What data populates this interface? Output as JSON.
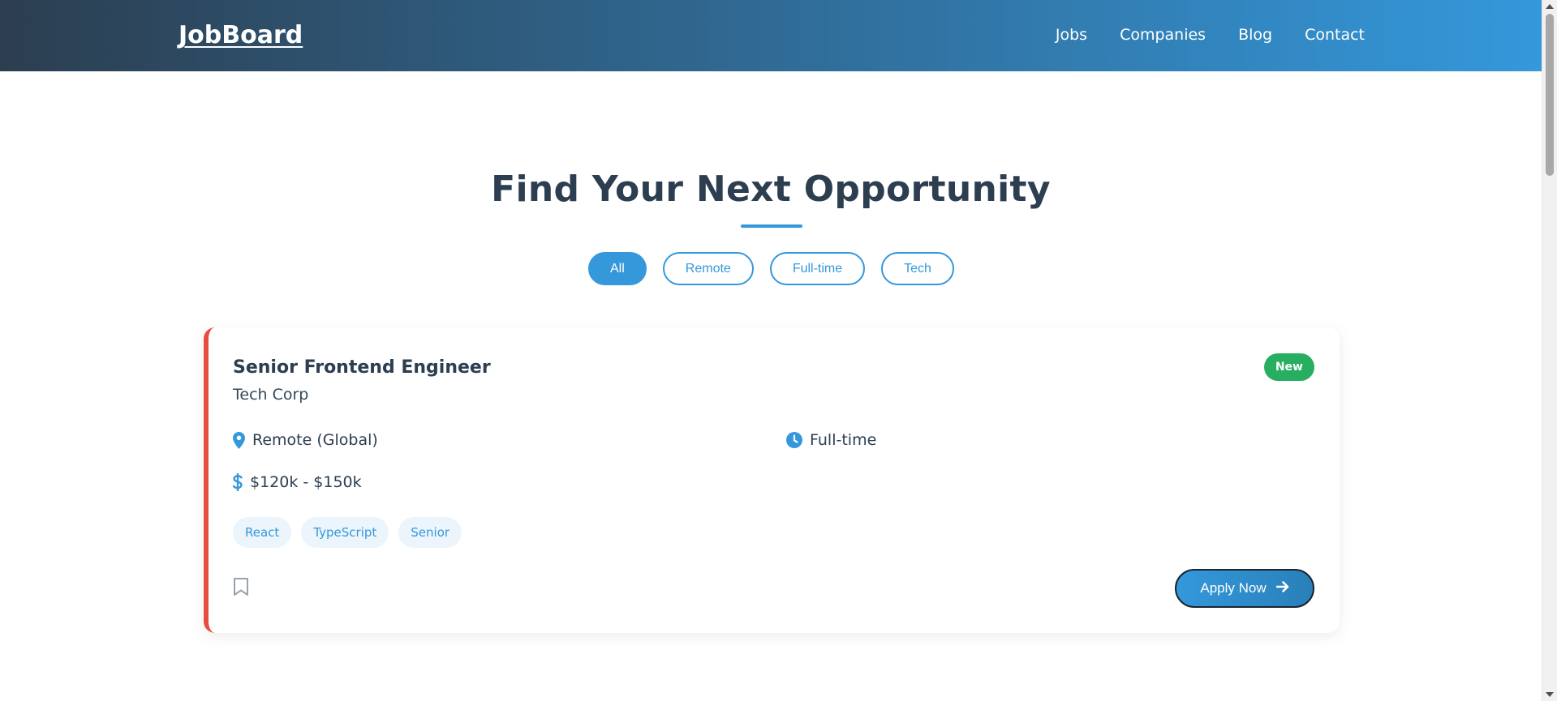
{
  "header": {
    "logo": "JobBoard",
    "nav": [
      "Jobs",
      "Companies",
      "Blog",
      "Contact"
    ]
  },
  "main": {
    "title": "Find Your Next Opportunity",
    "filters": [
      {
        "label": "All",
        "active": true
      },
      {
        "label": "Remote",
        "active": false
      },
      {
        "label": "Full-time",
        "active": false
      },
      {
        "label": "Tech",
        "active": false
      }
    ]
  },
  "job": {
    "title": "Senior Frontend Engineer",
    "company": "Tech Corp",
    "badge": "New",
    "location": "Remote (Global)",
    "type": "Full-time",
    "salary": "$120k - $150k",
    "tags": [
      "React",
      "TypeScript",
      "Senior"
    ],
    "apply_label": "Apply Now"
  },
  "icons": {
    "location": "map-pin-icon",
    "type": "clock-icon",
    "salary": "dollar-icon",
    "bookmark": "bookmark-icon",
    "apply": "arrow-right-icon"
  },
  "colors": {
    "primary": "#3498db",
    "dark": "#2c3e50",
    "accent_border": "#e74c3c",
    "badge": "#27ae60",
    "tag_bg": "#ebf5fb"
  }
}
